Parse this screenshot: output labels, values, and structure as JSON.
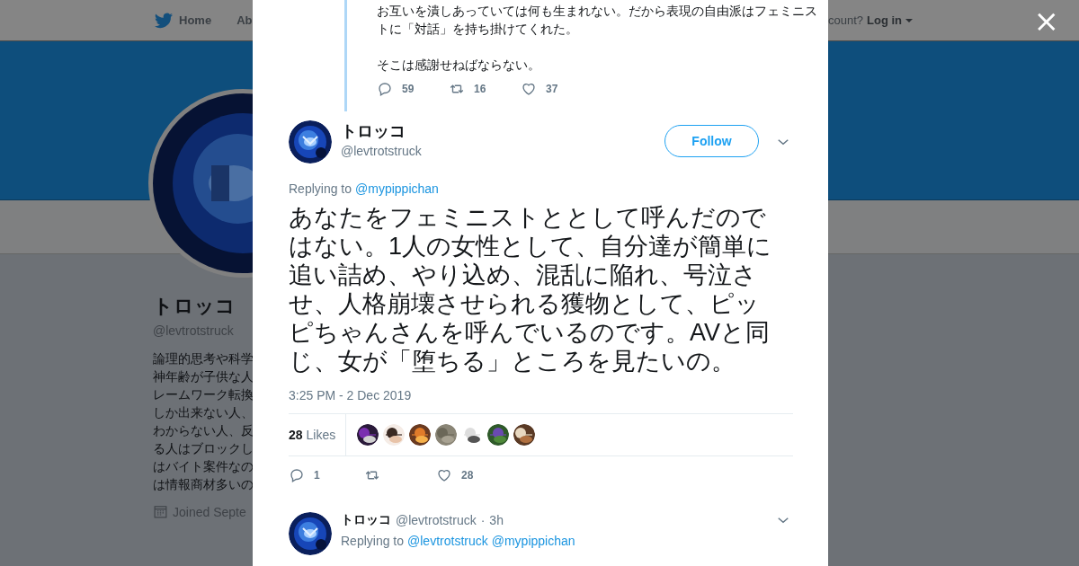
{
  "background_page": {
    "nav": {
      "items": [
        {
          "label": "Home"
        },
        {
          "label": "Ab"
        }
      ],
      "login_prompt": "count?",
      "login": "Log in"
    },
    "profile": {
      "name": "トロッコ",
      "handle": "@levtrotstruck",
      "bio_lines": [
        "論理的思考や科学",
        "神年齢が子供な人",
        "レームワーク転換",
        "しか出来ない人、",
        "わからない人、反",
        "る人はブロックし",
        "はバイト案件なの",
        "は情報商材多いの"
      ],
      "joined": "Joined Septe"
    }
  },
  "close_label": "×",
  "previous_tweet": {
    "paragraphs": [
      "お互いを潰しあっていては何も生まれない。だから表現の自由派はフェミニストに「対話」を持ち掛けてくれた。",
      "そこは感謝せねばならない。"
    ],
    "replies": "59",
    "retweets": "16",
    "likes": "37"
  },
  "tweet": {
    "name": "トロッコ",
    "handle": "@levtrotstruck",
    "follow": "Follow",
    "replying_label": "Replying to",
    "replying_to": [
      "@mypippichan"
    ],
    "text": "あなたをフェミニストととして呼んだのではない。1人の女性として、自分達が簡単に追い詰め、やり込め、混乱に陥れ、号泣させ、人格崩壊させられる獲物として、ピッピちゃんさんを呼んでいるのです。AVと同じ、女が「堕ちる」ところを見たいの。",
    "timestamp": "3:25 PM - 2 Dec 2019",
    "like_count": "28",
    "likes_label": "Likes",
    "likers": [
      {
        "kind": "picture"
      },
      {
        "kind": "picture"
      },
      {
        "kind": "picture"
      },
      {
        "kind": "picture"
      },
      {
        "kind": "picture"
      },
      {
        "kind": "picture"
      },
      {
        "kind": "picture"
      }
    ],
    "replies": "1",
    "likes": "28"
  },
  "reply_tweet": {
    "name": "トロッコ",
    "handle": "@levtrotstruck",
    "separator": "·",
    "time": "3h",
    "replying_label": "Replying to",
    "replying_to": [
      "@levtrotstruck",
      "@mypippichan"
    ]
  }
}
